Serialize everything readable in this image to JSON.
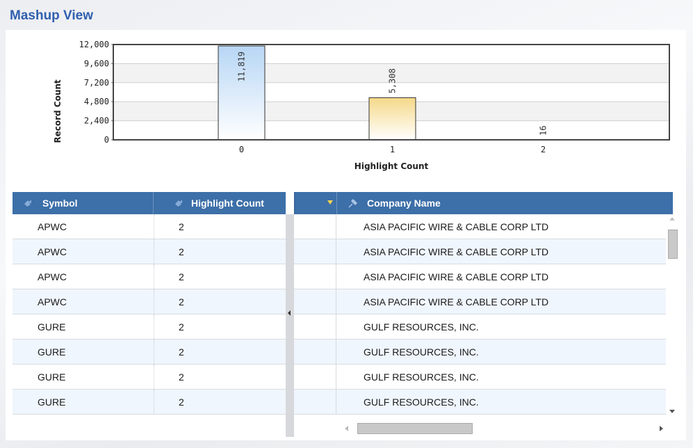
{
  "title": "Mashup View",
  "chart_data": {
    "type": "bar",
    "categories": [
      "0",
      "1",
      "2"
    ],
    "values": [
      11819,
      5308,
      16
    ],
    "value_labels": [
      "11,819",
      "5,308",
      "16"
    ],
    "bar_colors": [
      "#b7d6f5",
      "#f5d888",
      "#eeeeee"
    ],
    "xlabel": "Highlight Count",
    "ylabel": "Record Count",
    "ylim": [
      0,
      12000
    ],
    "yticks": [
      "12,000",
      "9,600",
      "7,200",
      "4,800",
      "2,400",
      "0"
    ],
    "grid": true
  },
  "table": {
    "columns": {
      "symbol": "Symbol",
      "highlight_count": "Highlight Count",
      "company_name": "Company Name"
    },
    "rows": [
      {
        "symbol": "APWC",
        "highlight_count": "2",
        "company_name": "ASIA PACIFIC WIRE & CABLE CORP LTD"
      },
      {
        "symbol": "APWC",
        "highlight_count": "2",
        "company_name": "ASIA PACIFIC WIRE & CABLE CORP LTD"
      },
      {
        "symbol": "APWC",
        "highlight_count": "2",
        "company_name": "ASIA PACIFIC WIRE & CABLE CORP LTD"
      },
      {
        "symbol": "APWC",
        "highlight_count": "2",
        "company_name": "ASIA PACIFIC WIRE & CABLE CORP LTD"
      },
      {
        "symbol": "GURE",
        "highlight_count": "2",
        "company_name": "GULF RESOURCES, INC."
      },
      {
        "symbol": "GURE",
        "highlight_count": "2",
        "company_name": "GULF RESOURCES, INC."
      },
      {
        "symbol": "GURE",
        "highlight_count": "2",
        "company_name": "GULF RESOURCES, INC."
      },
      {
        "symbol": "GURE",
        "highlight_count": "2",
        "company_name": "GULF RESOURCES, INC."
      }
    ]
  },
  "colors": {
    "title": "#2f5fae",
    "header_bg": "#3d6fa8",
    "row_alt": "#f0f6fd"
  }
}
